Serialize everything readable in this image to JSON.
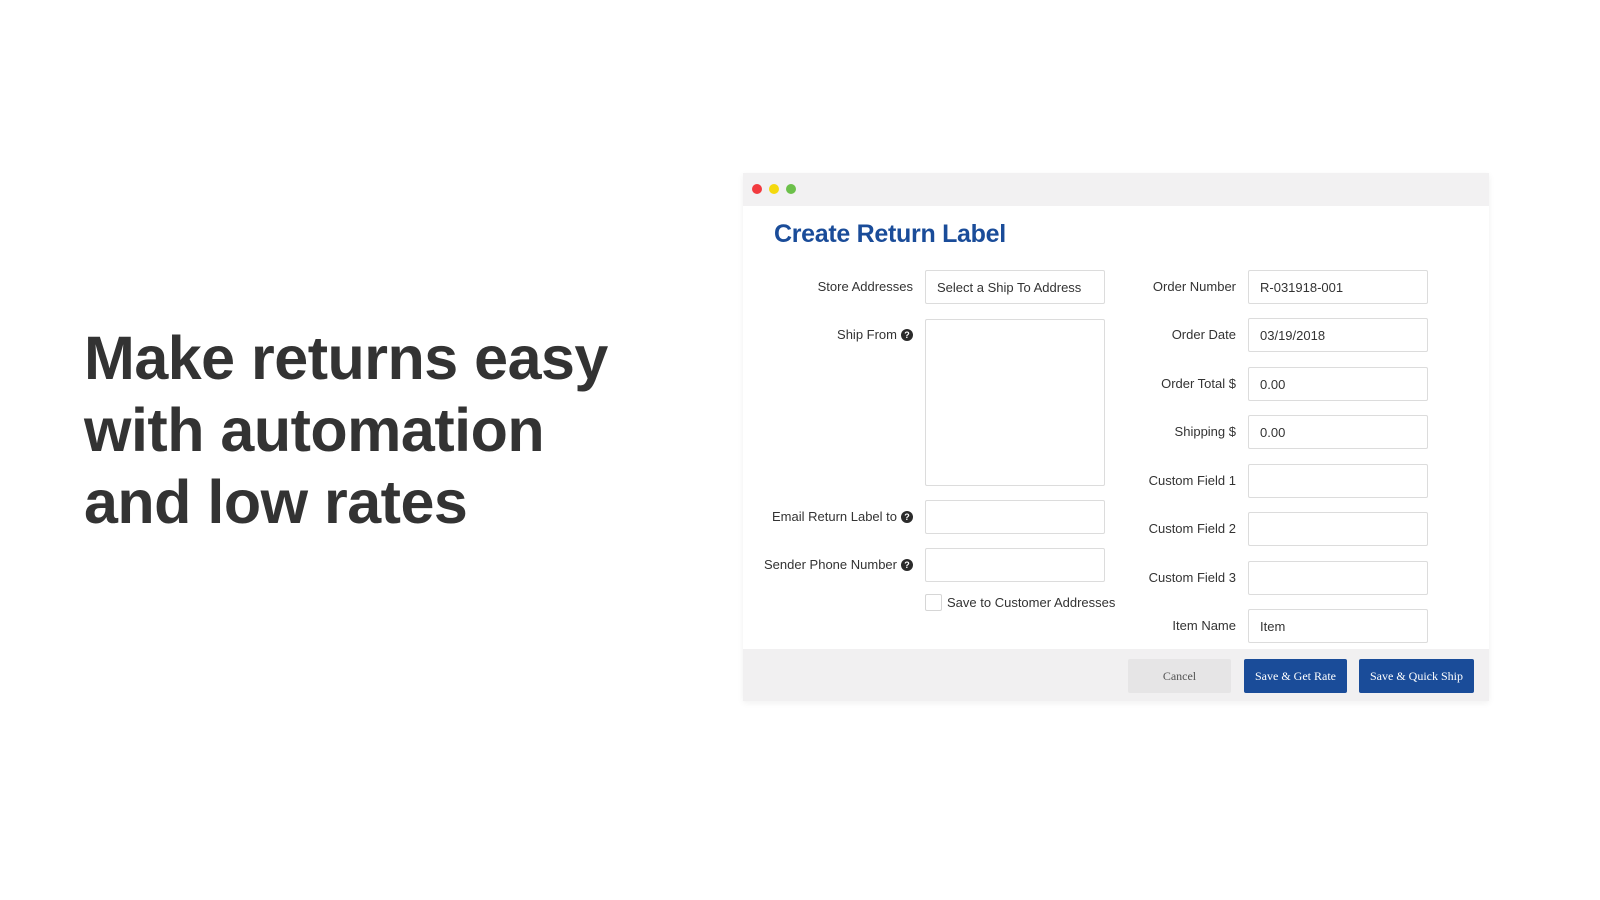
{
  "headline": {
    "lines": [
      "Make returns easy",
      "with automation",
      "and low rates"
    ]
  },
  "window": {
    "controls": [
      "close",
      "minimize",
      "maximize"
    ],
    "colors": {
      "close": "#f23a3f",
      "minimize": "#f4d90d",
      "maximize": "#6cc04a",
      "accent": "#1a4c99"
    }
  },
  "form": {
    "title": "Create Return Label",
    "left": {
      "store_addresses": {
        "label": "Store Addresses",
        "value": "Select a Ship To Address"
      },
      "ship_from": {
        "label": "Ship From",
        "value": "",
        "help_icon": "question-circle-icon"
      },
      "email_return_label": {
        "label": "Email Return Label to",
        "value": "",
        "help_icon": "question-circle-icon"
      },
      "sender_phone": {
        "label": "Sender Phone Number",
        "value": "",
        "help_icon": "question-circle-icon"
      },
      "save_to_customer": {
        "label": "Save to Customer Addresses",
        "checked": false
      }
    },
    "right": {
      "order_number": {
        "label": "Order Number",
        "value": "R-031918-001"
      },
      "order_date": {
        "label": "Order Date",
        "value": "03/19/2018"
      },
      "order_total": {
        "label": "Order Total $",
        "value": "0.00"
      },
      "shipping": {
        "label": "Shipping $",
        "value": "0.00"
      },
      "custom_field_1": {
        "label": "Custom Field 1",
        "value": ""
      },
      "custom_field_2": {
        "label": "Custom Field 2",
        "value": ""
      },
      "custom_field_3": {
        "label": "Custom Field 3",
        "value": ""
      },
      "item_name": {
        "label": "Item Name",
        "value": "Item"
      }
    },
    "help_glyph": "?"
  },
  "footer": {
    "cancel": "Cancel",
    "save_get_rate": "Save & Get Rate",
    "save_quick_ship": "Save & Quick Ship"
  }
}
